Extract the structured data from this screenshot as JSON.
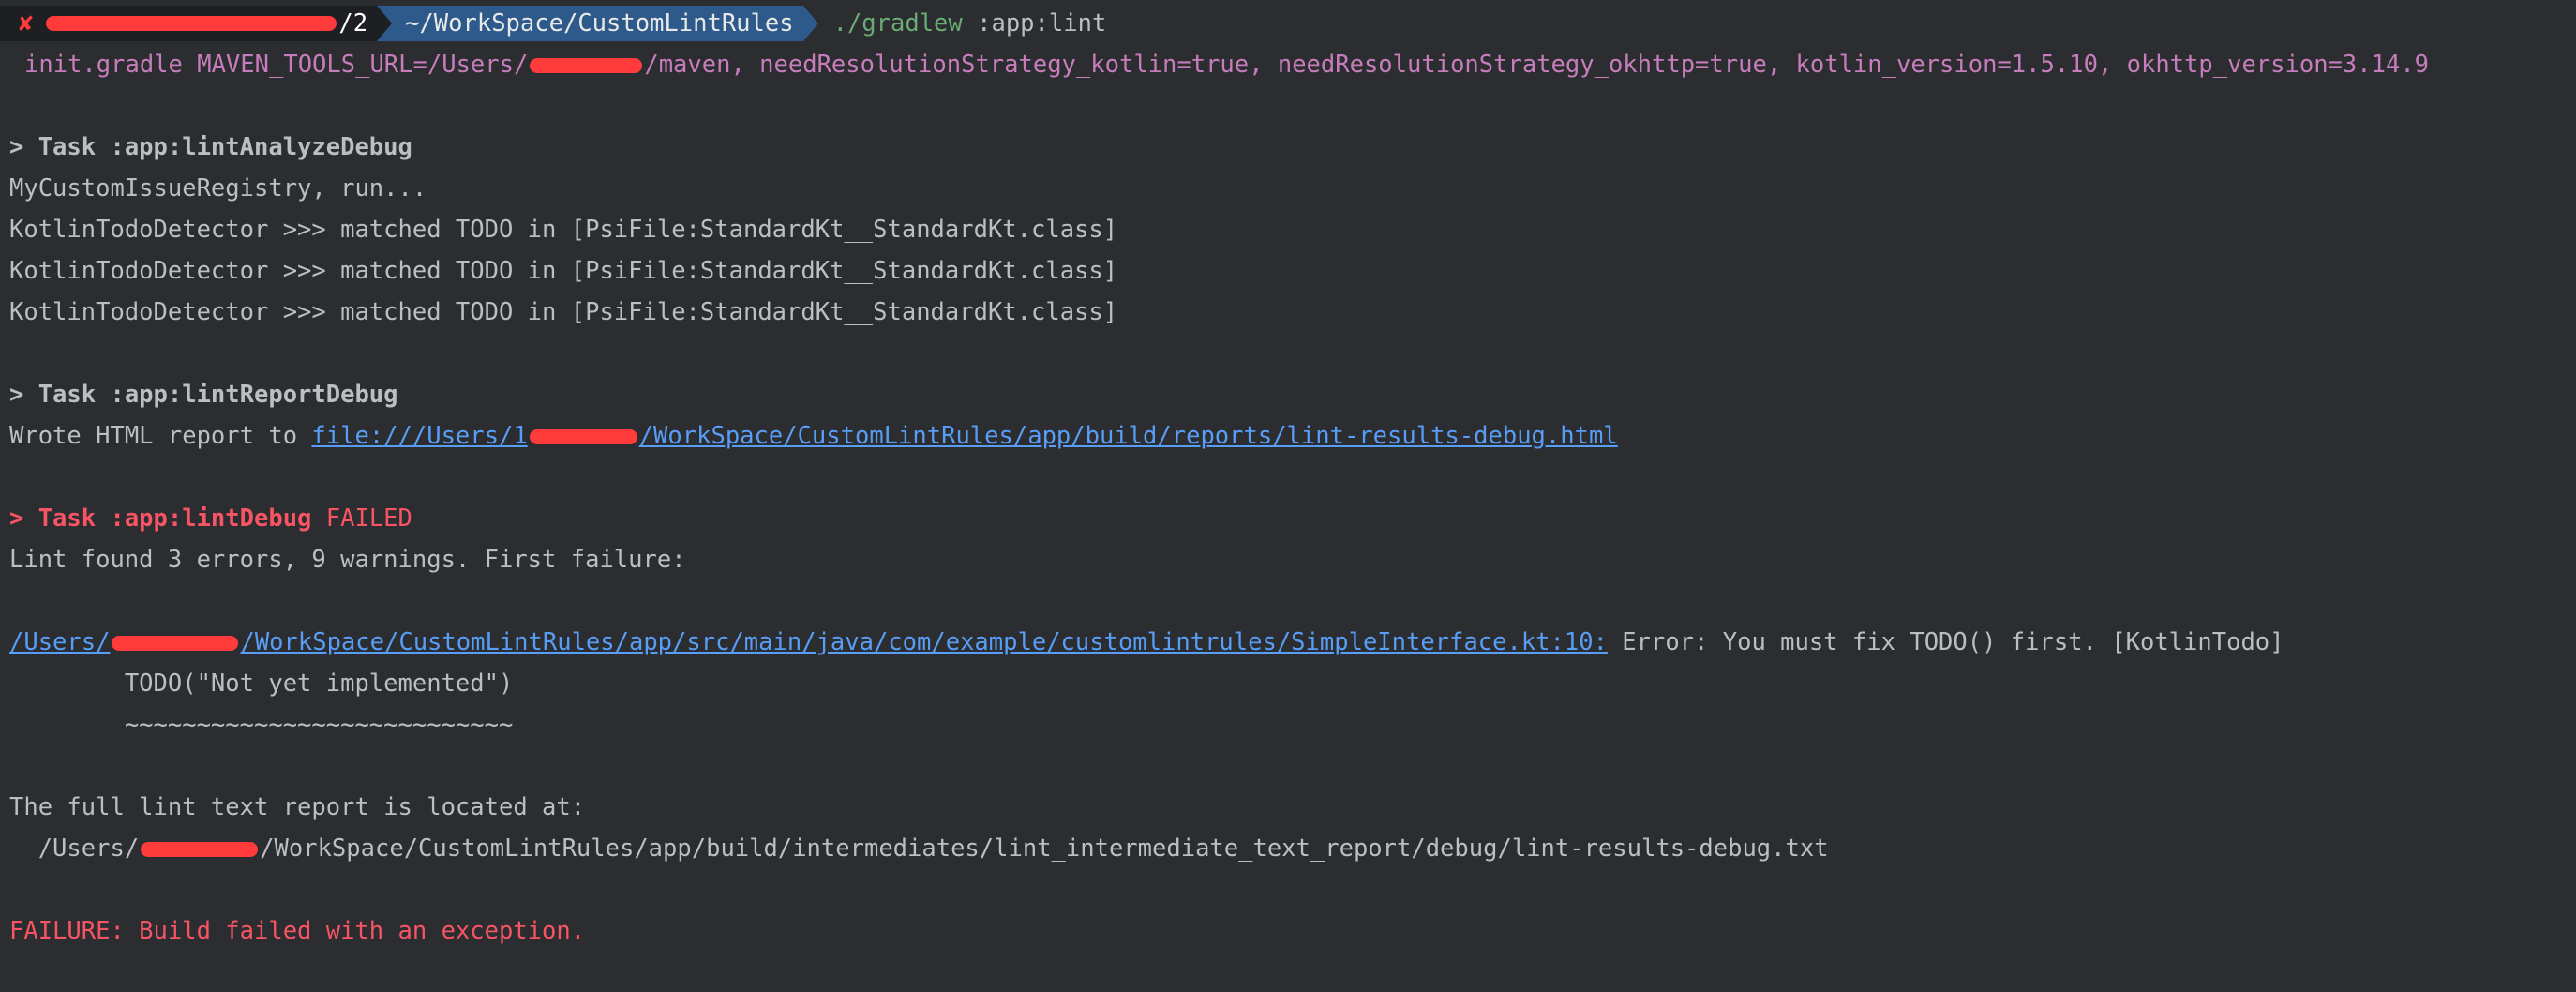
{
  "prompt": {
    "status_icon": "✘",
    "host_suffix": "/2",
    "path": "~/WorkSpace/CustomLintRules",
    "command": "./gradlew",
    "args": " :app:lint"
  },
  "init_line": "init.gradle MAVEN_TOOLS_URL=/Users/",
  "init_line_rest": "/maven, needResolutionStrategy_kotlin=true, needResolutionStrategy_okhttp=true, kotlin_version=1.5.10, okhttp_version=3.14.9",
  "task1": "> Task :app:lintAnalyzeDebug",
  "registry": "MyCustomIssueRegistry, run...",
  "todo_lines": [
    "KotlinTodoDetector >>> matched TODO in [PsiFile:StandardKt__StandardKt.class]",
    "KotlinTodoDetector >>> matched TODO in [PsiFile:StandardKt__StandardKt.class]",
    "KotlinTodoDetector >>> matched TODO in [PsiFile:StandardKt__StandardKt.class]"
  ],
  "task2": "> Task :app:lintReportDebug",
  "wrote_prefix": "Wrote HTML report to ",
  "wrote_link_a": "file:///Users/1",
  "wrote_link_b": "/WorkSpace/CustomLintRules/app/build/reports/lint-results-debug.html",
  "task3": "> Task :app:lintDebug",
  "task3_status": " FAILED",
  "summary": "Lint found 3 errors, 9 warnings. First failure:",
  "error_link_a": "/Users/",
  "error_link_b": "/WorkSpace/CustomLintRules/app/src/main/java/com/example/customlintrules/SimpleInterface.kt:10:",
  "error_msg": " Error: You must fix TODO() first. [KotlinTodo]",
  "code_line": "        TODO(\"Not yet implemented\")",
  "underline_line": "        ~~~~~~~~~~~~~~~~~~~~~~~~~~~",
  "full_report": "The full lint text report is located at:",
  "report_path_a": "  /Users/",
  "report_path_b": "/WorkSpace/CustomLintRules/app/build/intermediates/lint_intermediate_text_report/debug/lint-results-debug.txt",
  "failure": "FAILURE: Build failed with an exception."
}
